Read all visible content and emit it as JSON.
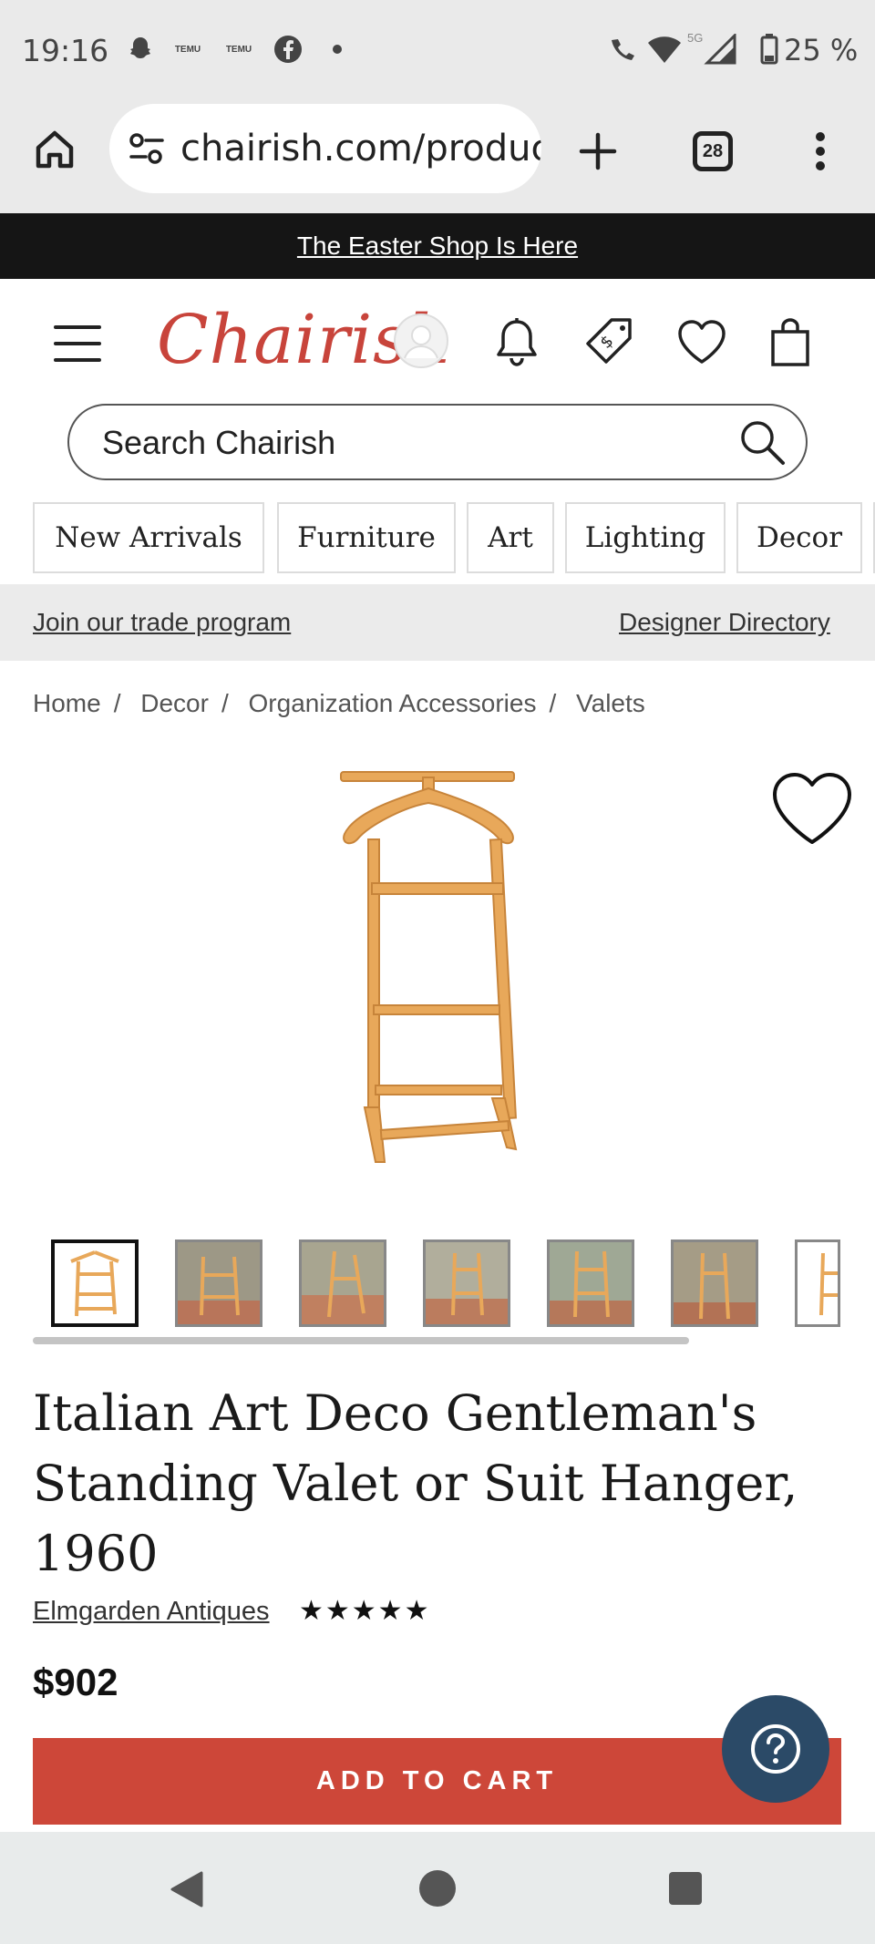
{
  "status_bar": {
    "time": "19:16",
    "notification_icons": [
      "snapchat-icon",
      "temu-icon",
      "temu-icon",
      "facebook-icon",
      "dot-icon"
    ],
    "temu_label": "TEMU",
    "network": "5G",
    "battery": "25 %"
  },
  "browser": {
    "url": "chairish.com/product",
    "tab_count": "28"
  },
  "promo": {
    "text": "The Easter Shop Is Here"
  },
  "header": {
    "logo": "Chairish",
    "icons": [
      "menu-icon",
      "account-icon",
      "bell-icon",
      "price-tag-icon",
      "heart-icon",
      "shopping-bag-icon"
    ]
  },
  "search": {
    "placeholder": "Search Chairish"
  },
  "categories": [
    "New Arrivals",
    "Furniture",
    "Art",
    "Lighting",
    "Decor"
  ],
  "trade_bar": {
    "left_link": "Join our trade program",
    "right_link": "Designer Directory"
  },
  "breadcrumbs": [
    "Home",
    "Decor",
    "Organization Accessories",
    "Valets"
  ],
  "breadcrumb_separator": "/",
  "product": {
    "title": "Italian Art Deco Gentleman's Standing Valet or Suit Hanger, 1960",
    "seller": "Elmgarden Antiques",
    "rating_stars": "★★★★★",
    "price": "$902",
    "add_to_cart": "ADD TO CART",
    "thumbnail_count": 7,
    "wood_color": "#e8a85a"
  },
  "colors": {
    "brand_red": "#c8443b",
    "cart_red": "#cd4739",
    "help_blue": "#2b4a67"
  }
}
